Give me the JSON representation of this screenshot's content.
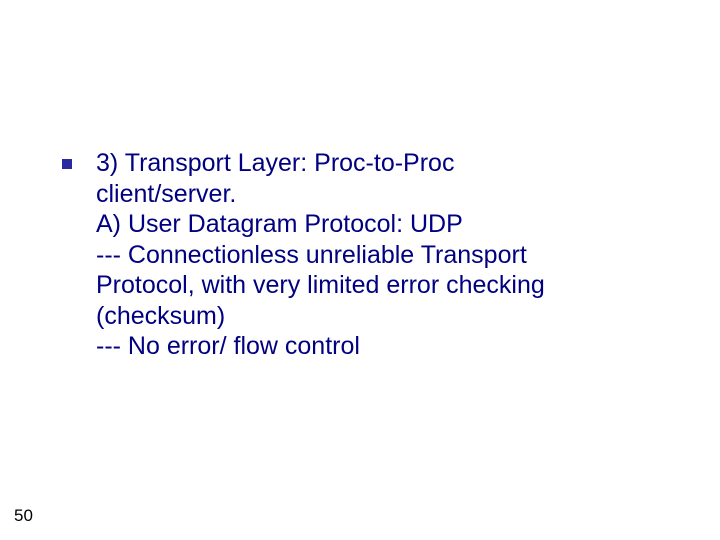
{
  "slide": {
    "bullet": {
      "lines": "3) Transport Layer: Proc-to-Proc\nclient/server.\nA) User Datagram Protocol: UDP\n--- Connectionless unreliable Transport\nProtocol, with very limited error checking\n(checksum)\n--- No error/ flow control"
    },
    "page_number": "50"
  },
  "colors": {
    "text": "#000080",
    "bullet_square": "#2a2aa0",
    "background": "#ffffff"
  }
}
